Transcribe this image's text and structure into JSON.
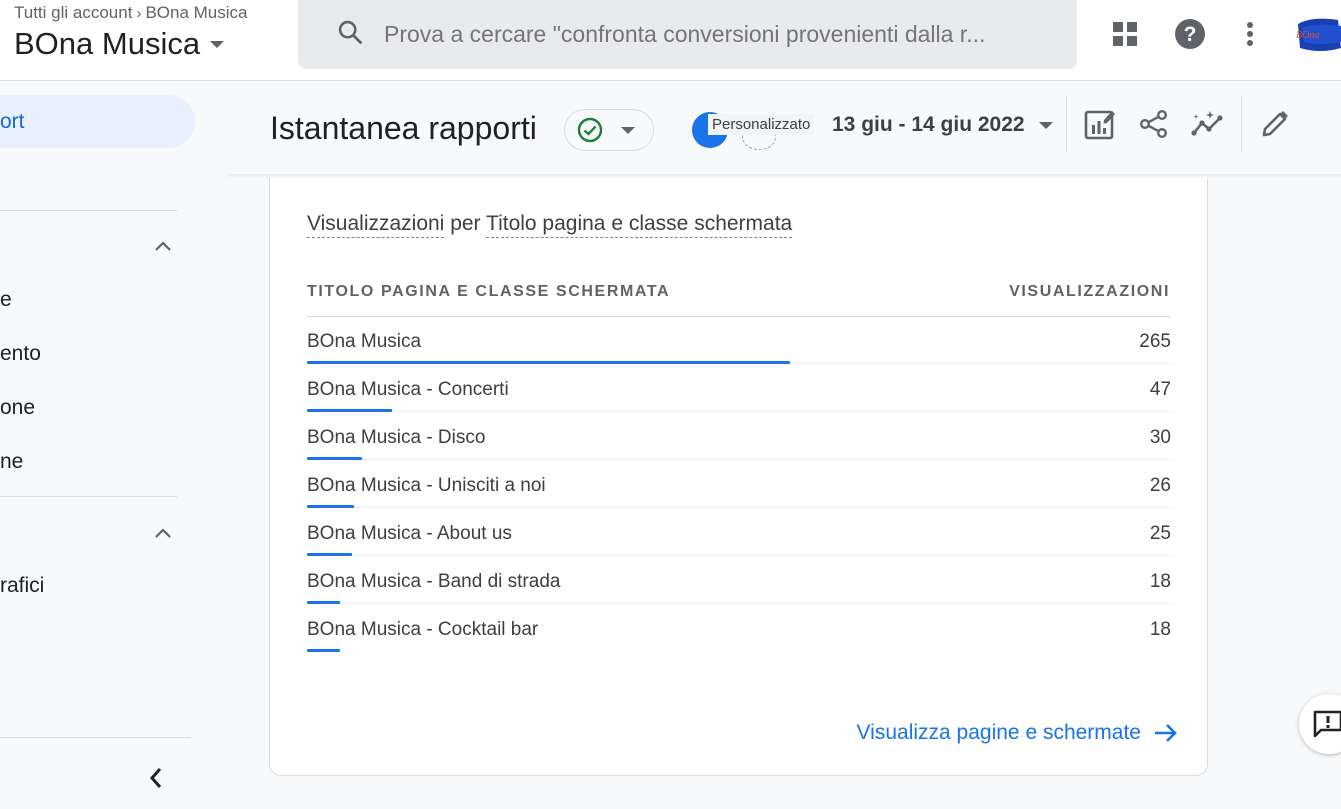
{
  "header": {
    "breadcrumb": [
      "Tutti gli account",
      "BOna Musica"
    ],
    "breadcrumb_sep": "›",
    "property_name": "BOna Musica",
    "search_placeholder": "Prova a cercare \"confronta conversioni provenienti dalla r...",
    "icons": [
      "apps-grid-icon",
      "help-icon",
      "more-vert-icon",
      "account-avatar"
    ]
  },
  "sidebar": {
    "active_item": "ort",
    "items": [
      {
        "label": "e"
      },
      {
        "label": "ento"
      },
      {
        "label": "one"
      },
      {
        "label": "ne"
      },
      {
        "label": "rafici"
      }
    ]
  },
  "report": {
    "title": "Istantanea rapporti",
    "date_preset": "Personalizzato",
    "date_range": "13 giu - 14 giu 2022"
  },
  "card": {
    "title_metric": "Visualizzazioni",
    "title_mid": " per ",
    "title_dimension": "Titolo pagina e classe schermata",
    "col_dimension": "TITOLO PAGINA E CLASSE SCHERMATA",
    "col_metric": "VISUALIZZAZIONI",
    "rows": [
      {
        "label": "BOna Musica",
        "value": "265",
        "share": 1.0
      },
      {
        "label": "BOna Musica - Concerti",
        "value": "47",
        "share": 0.177
      },
      {
        "label": "BOna Musica - Disco",
        "value": "30",
        "share": 0.113
      },
      {
        "label": "BOna Musica - Unisciti a noi",
        "value": "26",
        "share": 0.098
      },
      {
        "label": "BOna Musica - About us",
        "value": "25",
        "share": 0.094
      },
      {
        "label": "BOna Musica - Band di strada",
        "value": "18",
        "share": 0.068
      },
      {
        "label": "BOna Musica - Cocktail bar",
        "value": "18",
        "share": 0.068
      }
    ],
    "link_label": "Visualizza pagine e schermate"
  },
  "colors": {
    "accent": "#1a73e8",
    "success": "#188038",
    "active_bg": "#e8f0fe"
  }
}
